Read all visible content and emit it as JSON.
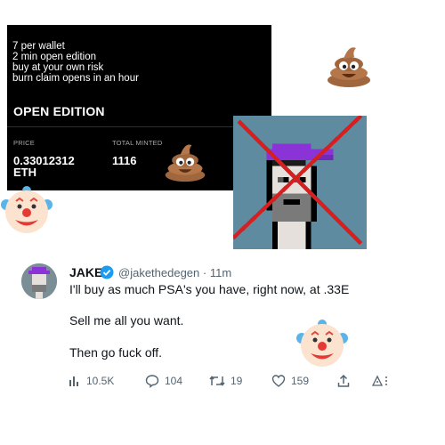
{
  "mint_panel": {
    "notes": [
      "7 per wallet",
      "2 min open edition",
      "buy at your own risk",
      "burn claim opens in an hour"
    ],
    "title": "OPEN EDITION",
    "price_label": "PRICE",
    "price_value_line1": "0.33012312",
    "price_value_line2": "ETH",
    "minted_label": "TOTAL MINTED",
    "minted_value": "1116"
  },
  "tweet": {
    "display_name": "JAKE",
    "handle": "@jakethedegen",
    "separator": "·",
    "time": "11m",
    "lines": [
      "I'll buy as much PSA's you have, right now, at .33E",
      "Sell me all you want.",
      "Then go fuck off."
    ],
    "actions": {
      "views": "10.5K",
      "replies": "104",
      "retweets": "19",
      "likes": "159"
    }
  },
  "colors": {
    "panel_bg": "#000000",
    "verified_blue": "#1d9bf0",
    "cross_red": "#d42020",
    "punk_bg": "#5f8ba0",
    "punk_cap": "#8a33d6"
  },
  "icons": [
    "poop-emoji",
    "clown-emoji",
    "verified-badge-icon",
    "views-icon",
    "reply-icon",
    "retweet-icon",
    "like-icon",
    "share-icon",
    "more-icon"
  ]
}
